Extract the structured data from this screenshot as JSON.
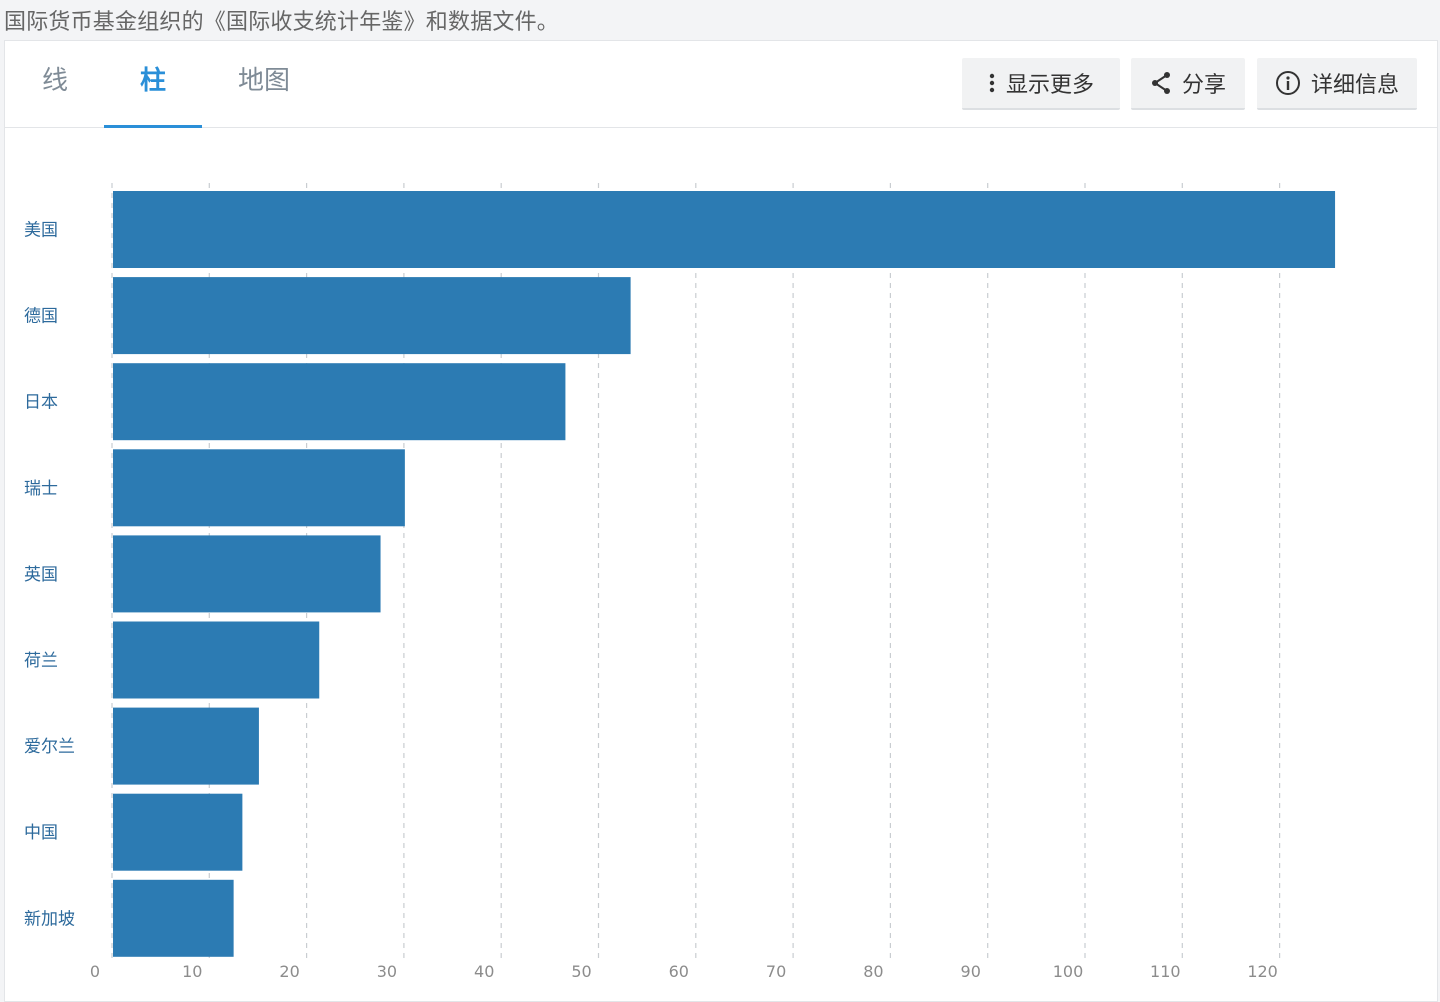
{
  "source_text": "国际货币基金组织的《国际收支统计年鉴》和数据文件。",
  "tabs": [
    {
      "label": "线",
      "active": false
    },
    {
      "label": "柱",
      "active": true
    },
    {
      "label": "地图",
      "active": false
    }
  ],
  "toolbar": {
    "show_more_label": "显示更多",
    "show_more_icon": "vertical-dots-icon",
    "share_label": "分享",
    "share_icon": "share-icon",
    "details_label": "详细信息",
    "details_icon": "info-icon"
  },
  "colors": {
    "bar": "#2c7bb3",
    "active_tab": "#2a8fd8",
    "category_label": "#2d6a9c"
  },
  "chart_data": {
    "type": "bar",
    "orientation": "horizontal",
    "categories": [
      "美国",
      "德国",
      "日本",
      "瑞士",
      "英国",
      "荷兰",
      "爱尔兰",
      "中国",
      "新加坡"
    ],
    "values": [
      125.7,
      53.3,
      46.6,
      30.1,
      27.6,
      21.3,
      15.1,
      13.4,
      12.5
    ],
    "x_ticks": [
      "0",
      "10",
      "20",
      "30",
      "40",
      "50",
      "60",
      "70",
      "80",
      "90",
      "100",
      "110",
      "120"
    ],
    "xlim": [
      0,
      120
    ],
    "grid": "vertical dashed",
    "title": "",
    "xlabel": "",
    "ylabel": ""
  }
}
